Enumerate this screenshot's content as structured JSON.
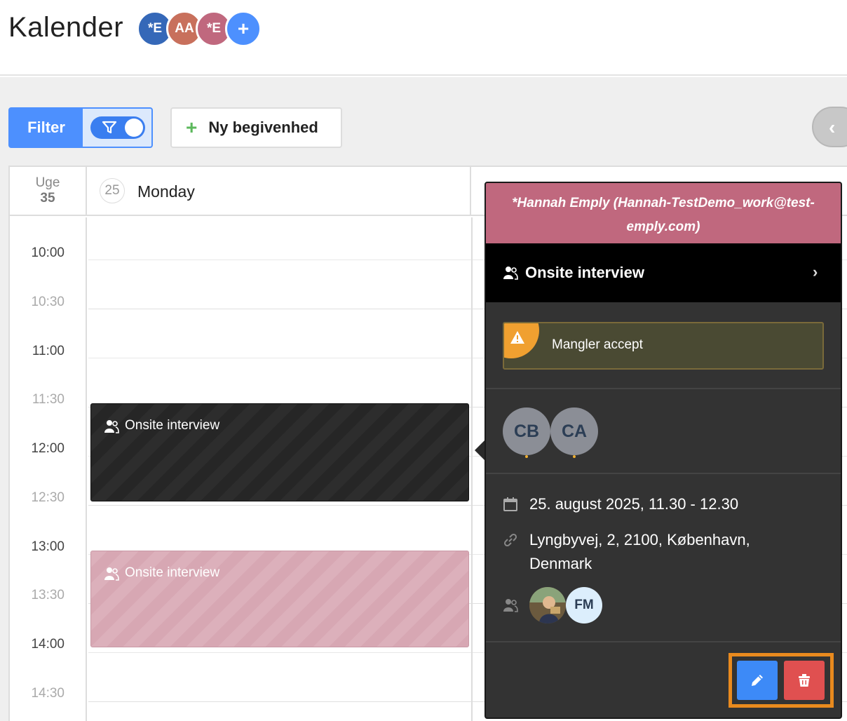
{
  "header": {
    "title": "Kalender",
    "avatars": [
      {
        "initials": "*E",
        "color": "#3568b8"
      },
      {
        "initials": "AA",
        "color": "#c8705c"
      },
      {
        "initials": "*E",
        "color": "#c0687e"
      },
      {
        "initials": "+",
        "color": "#4d90fe"
      }
    ]
  },
  "toolbar": {
    "filter_label": "Filter",
    "new_event_label": "Ny begivenhed",
    "filter_toggle_on": true
  },
  "calendar": {
    "week_label": "Uge",
    "week_number": "35",
    "day_number": "25",
    "day_name": "Monday",
    "times": [
      "10:00",
      "10:30",
      "11:00",
      "11:30",
      "12:00",
      "12:30",
      "13:00",
      "13:30",
      "14:00",
      "14:30"
    ],
    "events": [
      {
        "title": "Onsite interview",
        "style": "dark"
      },
      {
        "title": "Onsite interview",
        "style": "pink"
      }
    ]
  },
  "popover": {
    "owner": "*Hannah Emply (Hannah-TestDemo_work@test-emply.com)",
    "title": "Onsite interview",
    "warning": "Mangler accept",
    "attendees": [
      "CB",
      "CA"
    ],
    "date": "25. august 2025, 11.30 - 12.30",
    "location": "Lyngbyvej, 2, 2100, København, Denmark",
    "participants": [
      "FM"
    ]
  },
  "colors": {
    "accent": "#4d90fe",
    "owner_header": "#c0687e",
    "popover_bg": "#333333",
    "warning": "#f0a030",
    "delete": "#e05050",
    "highlight_frame": "#e98a1e"
  }
}
